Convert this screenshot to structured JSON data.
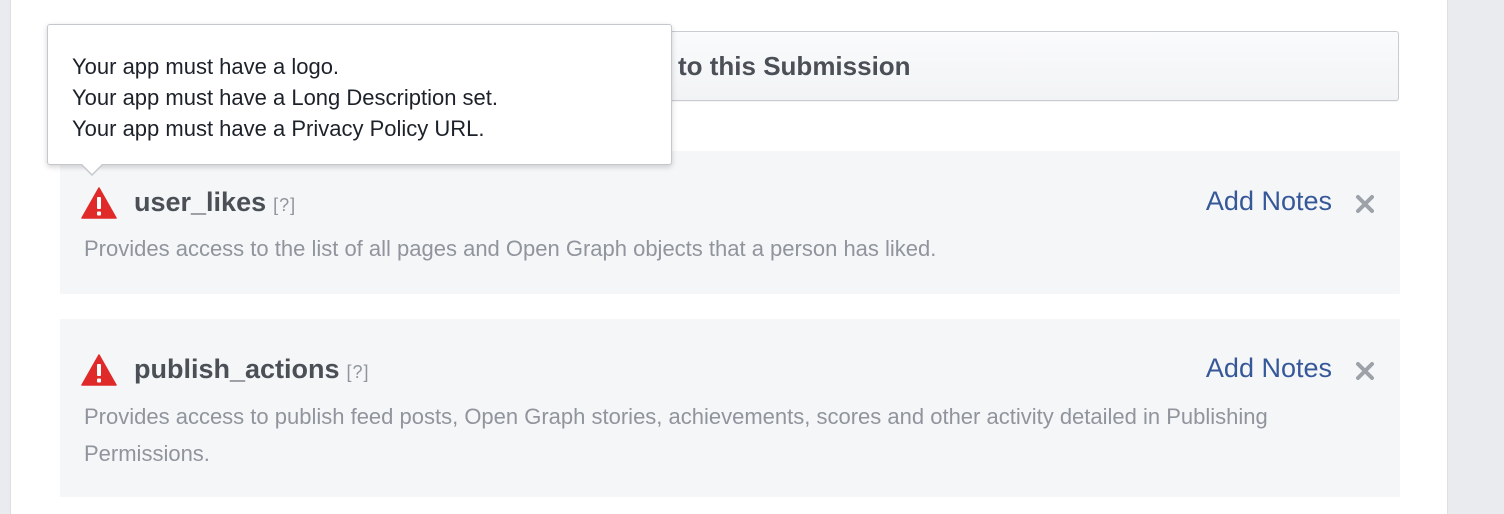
{
  "submission": {
    "add_button_label": "to this Submission"
  },
  "tooltip": {
    "lines": [
      "Your app must have a logo.",
      "Your app must have a Long Description set.",
      "Your app must have a Privacy Policy URL."
    ]
  },
  "permissions": [
    {
      "name": "user_likes",
      "help": "[?]",
      "description": "Provides access to the list of all pages and Open Graph objects that a person has liked.",
      "notes_label": "Add Notes"
    },
    {
      "name": "publish_actions",
      "help": "[?]",
      "description": "Provides access to publish feed posts, Open Graph stories, achievements, scores and other activity detailed in Publishing Permissions.",
      "notes_label": "Add Notes"
    }
  ],
  "colors": {
    "warning": "#e02a2a",
    "link": "#365899",
    "row_background": "#f5f6f8"
  },
  "icons": {
    "warning": "warning-triangle-icon",
    "remove": "close-icon"
  }
}
